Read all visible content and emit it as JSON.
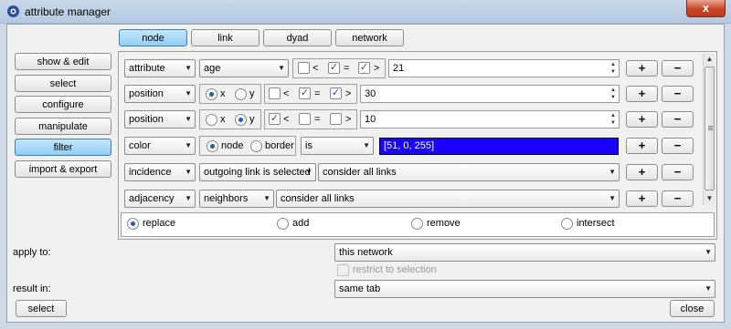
{
  "window": {
    "title": "attribute manager",
    "close_glyph": "x"
  },
  "tabs": [
    "node",
    "link",
    "dyad",
    "network"
  ],
  "active_tab": "node",
  "sidebar": [
    "show & edit",
    "select",
    "configure",
    "manipulate",
    "filter",
    "import & export"
  ],
  "active_sidebar": "filter",
  "rows": {
    "r1": {
      "type": "attribute",
      "name": "age",
      "lt": "<",
      "eq": "=",
      "gt": ">",
      "value": "21"
    },
    "r2": {
      "type": "position",
      "x": "x",
      "y": "y",
      "lt": "<",
      "eq": "=",
      "gt": ">",
      "value": "30"
    },
    "r3": {
      "type": "position",
      "x": "x",
      "y": "y",
      "lt": "<",
      "eq": "=",
      "gt": ">",
      "value": "10"
    },
    "r4": {
      "type": "color",
      "node": "node",
      "border": "border",
      "op": "is",
      "value": "[51, 0, 255]"
    },
    "r5": {
      "type": "incidence",
      "which": "outgoing link is selected",
      "scope": "consider all links"
    },
    "r6": {
      "type": "adjacency",
      "which": "neighbors",
      "scope": "consider all links"
    }
  },
  "row_buttons": {
    "plus": "+",
    "minus": "−"
  },
  "mode": {
    "replace": "replace",
    "add": "add",
    "remove": "remove",
    "intersect": "intersect",
    "selected": "replace"
  },
  "apply_to": {
    "label": "apply to:",
    "value": "this network",
    "restrict": "restrict to selection"
  },
  "result_in": {
    "label": "result in:",
    "value": "same tab"
  },
  "footer": {
    "select": "select",
    "close": "close"
  },
  "colors": {
    "filter_value_color": "#3300ff",
    "active_button": "#8fcdf4"
  },
  "icons": [
    "app-icon",
    "chevron-down-icon",
    "spin-icon"
  ]
}
